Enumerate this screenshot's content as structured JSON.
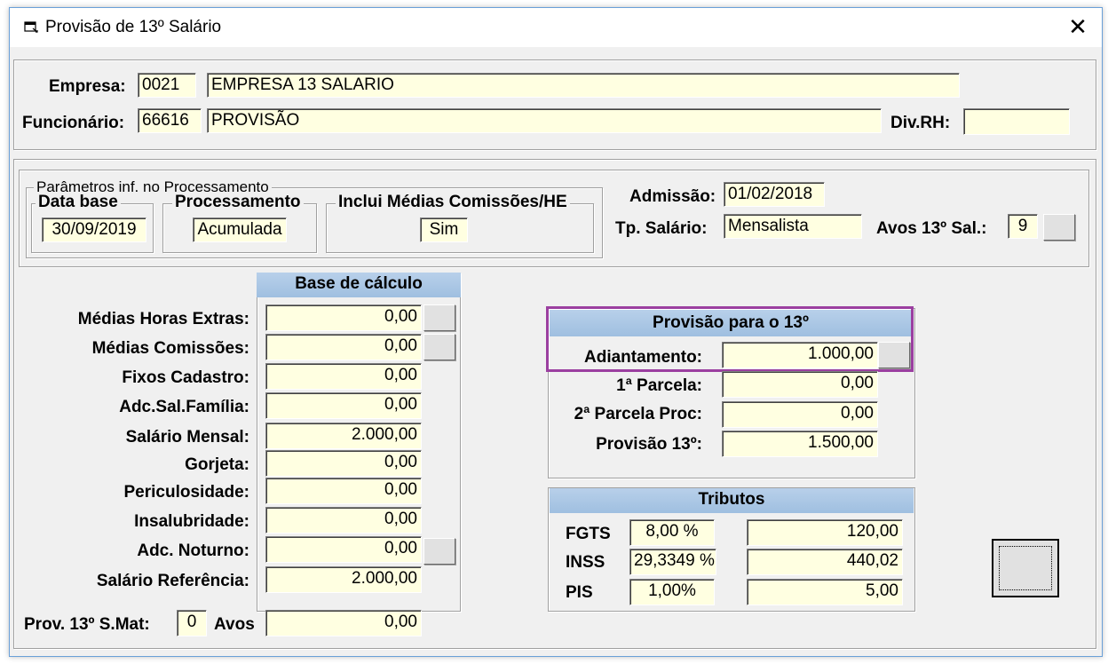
{
  "window": {
    "title": "Provisão de 13º Salário",
    "close_symbol": "✕"
  },
  "header": {
    "empresa_label": "Empresa:",
    "empresa_code": "0021",
    "empresa_name": "EMPRESA 13 SALARIO",
    "funcionario_label": "Funcionário:",
    "funcionario_code": "66616",
    "funcionario_name": "PROVISÃO",
    "divrh_label": "Div.RH:",
    "divrh_value": ""
  },
  "parametros": {
    "title": "Parâmetros inf. no Processamento",
    "data_base_label": "Data base",
    "data_base_value": "30/09/2019",
    "processamento_label": "Processamento",
    "processamento_value": "Acumulada",
    "inclui_label": "Inclui Médias Comissões/HE",
    "inclui_value": "Sim"
  },
  "info": {
    "admissao_label": "Admissão:",
    "admissao_value": "01/02/2018",
    "tp_salario_label": "Tp. Salário:",
    "tp_salario_value": "Mensalista",
    "avos_label": "Avos 13º Sal.:",
    "avos_value": "9"
  },
  "base_calculo": {
    "title": "Base de cálculo",
    "rows": [
      {
        "label": "Médias Horas Extras:",
        "value": "0,00"
      },
      {
        "label": "Médias Comissões:",
        "value": "0,00"
      },
      {
        "label": "Fixos Cadastro:",
        "value": "0,00"
      },
      {
        "label": "Adc.Sal.Família:",
        "value": "0,00"
      },
      {
        "label": "Salário Mensal:",
        "value": "2.000,00"
      },
      {
        "label": "Gorjeta:",
        "value": "0,00"
      },
      {
        "label": "Periculosidade:",
        "value": "0,00"
      },
      {
        "label": "Insalubridade:",
        "value": "0,00"
      },
      {
        "label": "Adc. Noturno:",
        "value": "0,00"
      },
      {
        "label": "Salário Referência:",
        "value": "2.000,00"
      }
    ]
  },
  "prov_smat": {
    "label": "Prov. 13º S.Mat:",
    "avos_value": "0",
    "avos_label": "Avos",
    "value": "0,00"
  },
  "provisao": {
    "title": "Provisão para o 13º",
    "rows": [
      {
        "label": "Adiantamento:",
        "value": "1.000,00"
      },
      {
        "label": "1ª Parcela:",
        "value": "0,00"
      },
      {
        "label": "2ª Parcela Proc:",
        "value": "0,00"
      },
      {
        "label": "Provisão 13º:",
        "value": "1.500,00"
      }
    ]
  },
  "tributos": {
    "title": "Tributos",
    "rows": [
      {
        "label": "FGTS",
        "rate": "8,00 %",
        "value": "120,00"
      },
      {
        "label": "INSS",
        "rate": "29,3349 %",
        "value": "440,02"
      },
      {
        "label": "PIS",
        "rate": "1,00%",
        "value": "5,00"
      }
    ]
  },
  "colors": {
    "highlight": "#9b3fa0",
    "field_bg": "#ffffe1",
    "header_bg": "#9fbfe0"
  }
}
